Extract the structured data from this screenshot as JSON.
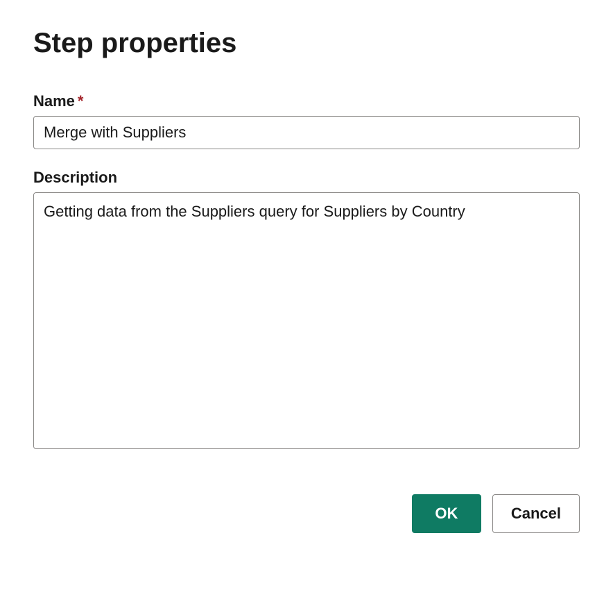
{
  "dialog": {
    "title": "Step properties"
  },
  "fields": {
    "name": {
      "label": "Name",
      "required_mark": "*",
      "value": "Merge with Suppliers"
    },
    "description": {
      "label": "Description",
      "value": "Getting data from the Suppliers query for Suppliers by Country"
    }
  },
  "buttons": {
    "ok": "OK",
    "cancel": "Cancel"
  }
}
